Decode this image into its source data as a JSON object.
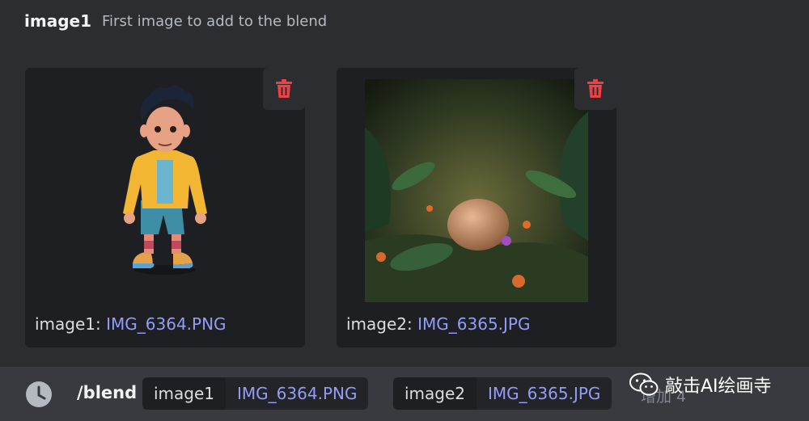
{
  "header": {
    "param_name": "image1",
    "param_description": "First image to add to the blend"
  },
  "cards": [
    {
      "label_prefix": "image1: ",
      "filename": "IMG_6364.PNG",
      "preview_icon": "cartoon-boy-3d-image",
      "action_icon": "trash-icon"
    },
    {
      "label_prefix": "image2: ",
      "filename": "IMG_6365.JPG",
      "preview_icon": "jungle-egg-image",
      "action_icon": "trash-icon"
    }
  ],
  "command_bar": {
    "icon": "clock-icon",
    "command": "/blend",
    "options": [
      {
        "name": "image1",
        "value": "IMG_6364.PNG"
      },
      {
        "name": "image2",
        "value": "IMG_6365.JPG"
      }
    ],
    "more_text": "增加 4"
  },
  "watermark": {
    "icon": "wechat-icon",
    "text": "敲击AI绘画寺"
  },
  "colors": {
    "accent_link": "#949cf7",
    "danger": "#f23f43",
    "background": "#313338",
    "panel": "#2b2d31"
  }
}
